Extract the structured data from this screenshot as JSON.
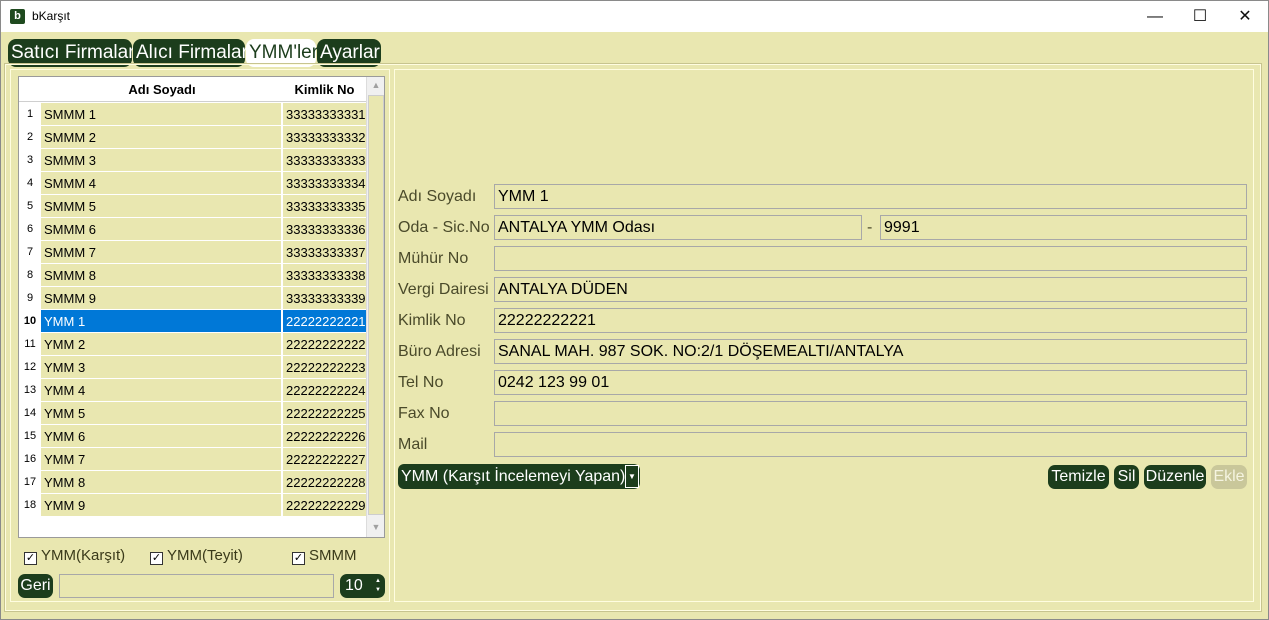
{
  "window": {
    "title": "bKarşıt",
    "icon_letter": "b",
    "controls": [
      "—",
      "☐",
      "✕"
    ]
  },
  "tabs": [
    {
      "label": "Satıcı Firmalar",
      "active": false
    },
    {
      "label": "Alıcı Firmalar",
      "active": false
    },
    {
      "label": "YMM'ler",
      "active": true
    },
    {
      "label": "Ayarlar",
      "active": false
    }
  ],
  "grid": {
    "columns": [
      "Adı Soyadı",
      "Kimlik No"
    ],
    "selected_row": 10,
    "rows": [
      {
        "num": "1",
        "name": "SMMM 1",
        "id": "33333333331"
      },
      {
        "num": "2",
        "name": "SMMM 2",
        "id": "33333333332"
      },
      {
        "num": "3",
        "name": "SMMM 3",
        "id": "33333333333"
      },
      {
        "num": "4",
        "name": "SMMM 4",
        "id": "33333333334"
      },
      {
        "num": "5",
        "name": "SMMM 5",
        "id": "33333333335"
      },
      {
        "num": "6",
        "name": "SMMM 6",
        "id": "33333333336"
      },
      {
        "num": "7",
        "name": "SMMM 7",
        "id": "33333333337"
      },
      {
        "num": "8",
        "name": "SMMM 8",
        "id": "33333333338"
      },
      {
        "num": "9",
        "name": "SMMM 9",
        "id": "33333333339"
      },
      {
        "num": "10",
        "name": "YMM 1",
        "id": "22222222221"
      },
      {
        "num": "11",
        "name": "YMM 2",
        "id": "22222222222"
      },
      {
        "num": "12",
        "name": "YMM 3",
        "id": "22222222223"
      },
      {
        "num": "13",
        "name": "YMM 4",
        "id": "22222222224"
      },
      {
        "num": "14",
        "name": "YMM 5",
        "id": "22222222225"
      },
      {
        "num": "15",
        "name": "YMM 6",
        "id": "22222222226"
      },
      {
        "num": "16",
        "name": "YMM 7",
        "id": "22222222227"
      },
      {
        "num": "17",
        "name": "YMM 8",
        "id": "22222222228"
      },
      {
        "num": "18",
        "name": "YMM 9",
        "id": "22222222229"
      }
    ]
  },
  "filters": [
    {
      "label": "YMM(Karşıt)",
      "checked": true
    },
    {
      "label": "YMM(Teyit)",
      "checked": true
    },
    {
      "label": "SMMM",
      "checked": true
    }
  ],
  "pager": {
    "back_label": "Geri",
    "search_value": "",
    "page_size": "10"
  },
  "form": {
    "name_label": "Adı Soyadı",
    "name_value": "YMM 1",
    "chamber_label": "Oda - Sic.No",
    "chamber_value": "ANTALYA YMM Odası",
    "separator": "-",
    "reg_no_value": "9991",
    "seal_label": "Mühür No",
    "seal_value": "",
    "tax_office_label": "Vergi Dairesi",
    "tax_office_value": "ANTALYA DÜDEN",
    "id_label": "Kimlik No",
    "id_value": "22222222221",
    "address_label": "Büro Adresi",
    "address_value": "SANAL MAH. 987 SOK. NO:2/1 DÖŞEMEALTI/ANTALYA",
    "tel_label": "Tel No",
    "tel_value": "0242 123 99 01",
    "fax_label": "Fax No",
    "fax_value": "",
    "mail_label": "Mail",
    "mail_value": "",
    "type_selected": "YMM (Karşıt İncelemeyi Yapan)"
  },
  "actions": {
    "clear_label": "Temizle",
    "delete_label": "Sil",
    "edit_label": "Düzenle",
    "add_label": "Ekle"
  },
  "colors": {
    "background": "#e9e7b0",
    "button": "#1c3d1c",
    "selection": "#0078d7"
  }
}
